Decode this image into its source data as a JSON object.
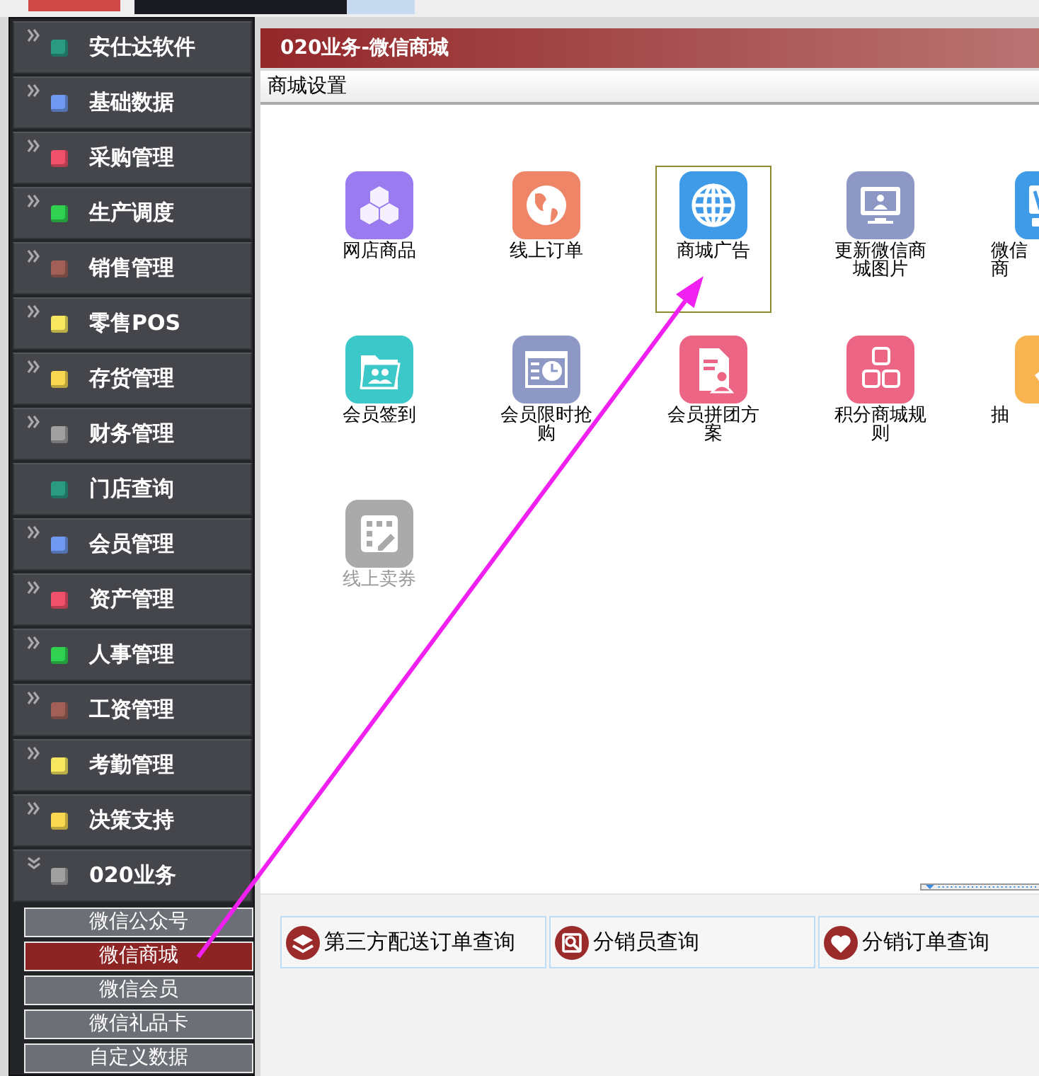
{
  "sidebar": {
    "items": [
      {
        "label": "安仕达软件",
        "color": "#2a9a80",
        "expandable": true,
        "expanded": false
      },
      {
        "label": "基础数据",
        "color": "#6f98f0",
        "expandable": true,
        "expanded": false
      },
      {
        "label": "采购管理",
        "color": "#f0506a",
        "expandable": true,
        "expanded": false
      },
      {
        "label": "生产调度",
        "color": "#30d050",
        "expandable": true,
        "expanded": false
      },
      {
        "label": "销售管理",
        "color": "#a06058",
        "expandable": true,
        "expanded": false
      },
      {
        "label": "零售POS",
        "color": "#f8e860",
        "expandable": true,
        "expanded": false
      },
      {
        "label": "存货管理",
        "color": "#f8d850",
        "expandable": true,
        "expanded": false
      },
      {
        "label": "财务管理",
        "color": "#a0a0a0",
        "expandable": true,
        "expanded": false
      },
      {
        "label": "门店查询",
        "color": "#2a9a80",
        "expandable": false,
        "expanded": false
      },
      {
        "label": "会员管理",
        "color": "#6f98f0",
        "expandable": true,
        "expanded": false
      },
      {
        "label": "资产管理",
        "color": "#f0506a",
        "expandable": true,
        "expanded": false
      },
      {
        "label": "人事管理",
        "color": "#30d050",
        "expandable": true,
        "expanded": false
      },
      {
        "label": "工资管理",
        "color": "#a06058",
        "expandable": true,
        "expanded": false
      },
      {
        "label": "考勤管理",
        "color": "#f8e860",
        "expandable": true,
        "expanded": false
      },
      {
        "label": "决策支持",
        "color": "#f8d850",
        "expandable": true,
        "expanded": false
      },
      {
        "label": "020业务",
        "color": "#a0a0a0",
        "expandable": true,
        "expanded": true,
        "children": [
          {
            "label": "微信公众号",
            "selected": false
          },
          {
            "label": "微信商城",
            "selected": true
          },
          {
            "label": "微信会员",
            "selected": false
          },
          {
            "label": "微信礼品卡",
            "selected": false
          },
          {
            "label": "自定义数据",
            "selected": false
          }
        ]
      }
    ]
  },
  "panel": {
    "title": "020业务-微信商城",
    "toolbar": "商城设置",
    "tiles": [
      {
        "lines": [
          "网店商品"
        ],
        "color": "#9b7cf0",
        "selected": false,
        "disabled": false,
        "cut_off": false
      },
      {
        "lines": [
          "线上订单"
        ],
        "color": "#ee8566",
        "selected": false,
        "disabled": false,
        "cut_off": false
      },
      {
        "lines": [
          "商城广告"
        ],
        "color": "#3f9ae8",
        "selected": true,
        "disabled": false,
        "cut_off": false
      },
      {
        "lines": [
          "更新微信商",
          "城图片"
        ],
        "color": "#8e98c4",
        "selected": false,
        "disabled": false,
        "cut_off": false
      },
      {
        "lines": [
          "微信",
          "商"
        ],
        "color": "#3f9ae8",
        "selected": false,
        "disabled": false,
        "cut_off": true
      },
      {
        "lines": [
          "会员签到"
        ],
        "color": "#3cc8c8",
        "selected": false,
        "disabled": false,
        "cut_off": false
      },
      {
        "lines": [
          "会员限时抢",
          "购"
        ],
        "color": "#8e98c4",
        "selected": false,
        "disabled": false,
        "cut_off": false
      },
      {
        "lines": [
          "会员拼团方",
          "案"
        ],
        "color": "#ec6584",
        "selected": false,
        "disabled": false,
        "cut_off": false
      },
      {
        "lines": [
          "积分商城规",
          "则"
        ],
        "color": "#ec6584",
        "selected": false,
        "disabled": false,
        "cut_off": false
      },
      {
        "lines": [
          "抽"
        ],
        "color": "#f8b450",
        "selected": false,
        "disabled": false,
        "cut_off": true
      },
      {
        "lines": [
          "线上卖券"
        ],
        "color": "#aaaaaa",
        "selected": false,
        "disabled": true,
        "cut_off": false
      }
    ],
    "links": [
      {
        "label": "第三方配送订单查询"
      },
      {
        "label": "分销员查询"
      },
      {
        "label": "分销订单查询"
      }
    ]
  }
}
